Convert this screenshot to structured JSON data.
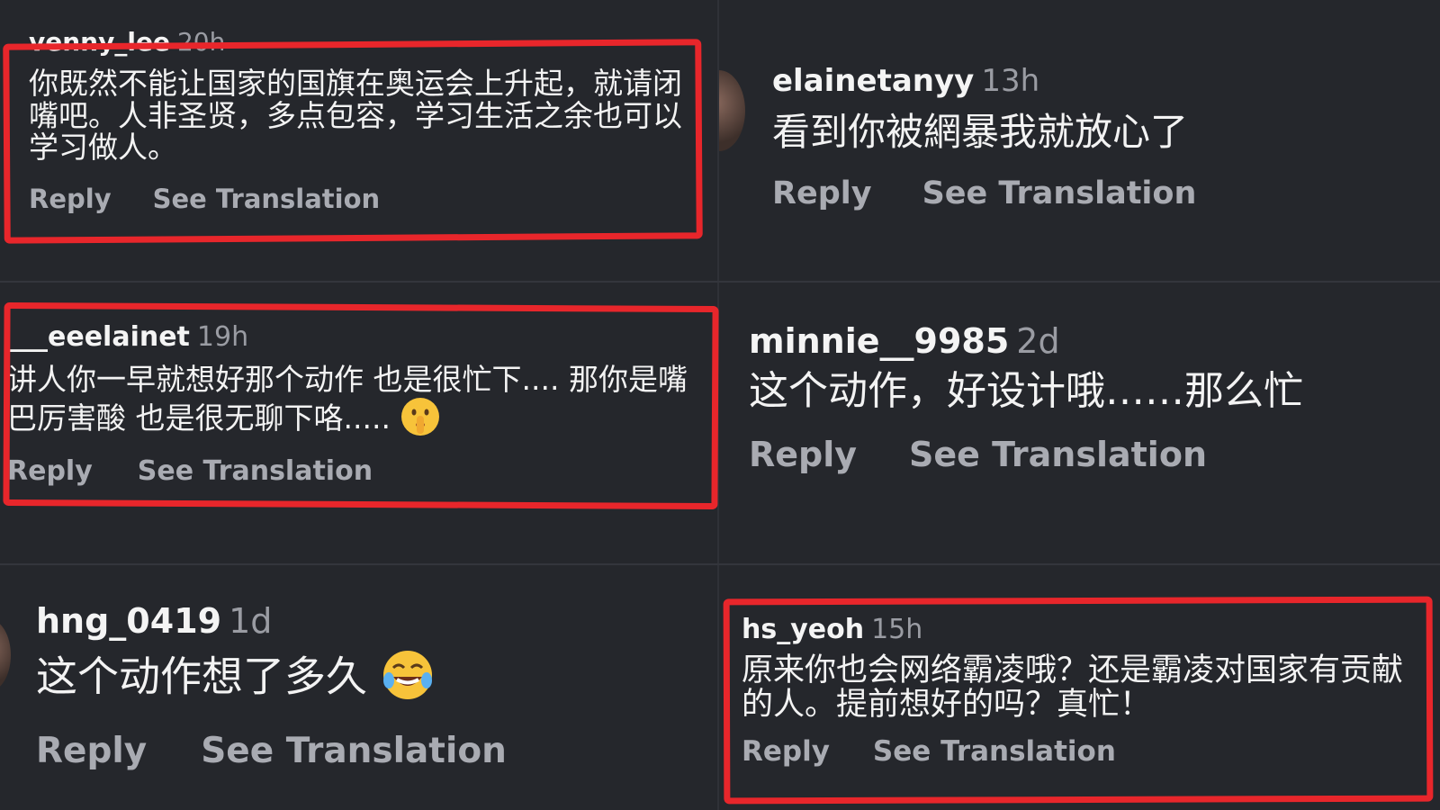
{
  "comments": [
    {
      "username": "venny_lee",
      "time": "20h",
      "text": "你既然不能让国家的国旗在奥运会上升起，就请闭嘴吧。人非圣贤，多点包容，学习生活之余也可以学习做人。",
      "reply": "Reply",
      "translate": "See Translation"
    },
    {
      "username": "elainetanyy",
      "time": "13h",
      "text": "看到你被網暴我就放心了",
      "reply": "Reply",
      "translate": "See Translation"
    },
    {
      "username": "___eeelainet",
      "time": "19h",
      "text": "讲人你一早就想好那个动作 也是很忙下.... 那你是嘴巴厉害酸 也是很无聊下咯.....",
      "emoji": "shushing-face-emoji",
      "reply": "Reply",
      "translate": "See Translation"
    },
    {
      "username": "minnie__9985",
      "time": "2d",
      "text": "这个动作，好设计哦……那么忙",
      "reply": "Reply",
      "translate": "See Translation"
    },
    {
      "username": "hng_0419",
      "time": "1d",
      "text": "这个动作想了多久",
      "emoji": "face-with-tears-of-joy-emoji",
      "reply": "Reply",
      "translate": "See Translation"
    },
    {
      "username": "hs_yeoh",
      "time": "15h",
      "text": "原来你也会网络霸凌哦？还是霸凌对国家有贡献的人。提前想好的吗？真忙！",
      "reply": "Reply",
      "translate": "See Translation"
    }
  ],
  "colors": {
    "highlight": "#e8262b",
    "background": "#25272c",
    "muted_text": "#a9abb2"
  }
}
